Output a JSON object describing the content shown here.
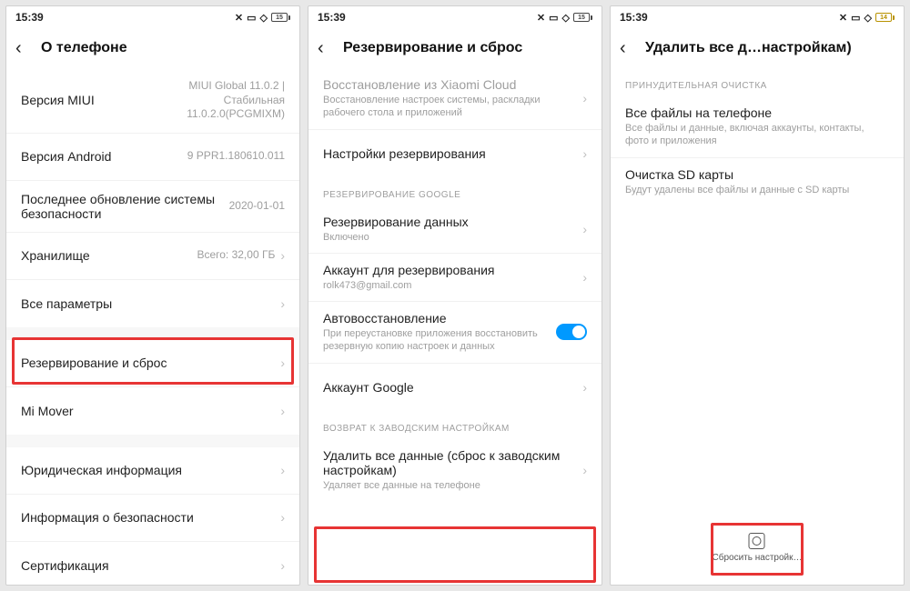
{
  "status": {
    "time": "15:39",
    "battery1": "15",
    "battery2": "15",
    "battery3": "14"
  },
  "s1": {
    "title": "О телефоне",
    "rows": {
      "miui_l": "Версия MIUI",
      "miui_v": "MIUI Global 11.0.2 | Стабильная 11.0.2.0(PCGMIXM)",
      "android_l": "Версия Android",
      "android_v": "9 PPR1.180610.011",
      "security_l": "Последнее обновление системы безопасности",
      "security_v": "2020-01-01",
      "storage_l": "Хранилище",
      "storage_v": "Всего: 32,00 ГБ",
      "allparams": "Все параметры",
      "backup": "Резервирование и сброс",
      "mover": "Mi Mover",
      "legal": "Юридическая информация",
      "secinfo": "Информация о безопасности",
      "cert": "Сертификация"
    }
  },
  "s2": {
    "title": "Резервирование и сброс",
    "rows": {
      "xiaomi_t": "Восстановление из Xiaomi Cloud",
      "xiaomi_s": "Восстановление настроек системы, раскладки рабочего стола и приложений",
      "backup_settings": "Настройки резервирования",
      "sec_google": "РЕЗЕРВИРОВАНИЕ GOOGLE",
      "data_t": "Резервирование данных",
      "data_s": "Включено",
      "acct_t": "Аккаунт для резервирования",
      "acct_s": "rolk473@gmail.com",
      "auto_t": "Автовосстановление",
      "auto_s": "При переустановке приложения восстановить резервную копию настроек и данных",
      "google_acct": "Аккаунт Google",
      "sec_factory": "ВОЗВРАТ К ЗАВОДСКИМ НАСТРОЙКАМ",
      "erase_t": "Удалить все данные (сброс к заводским настройкам)",
      "erase_s": "Удаляет все данные на телефоне"
    }
  },
  "s3": {
    "title": "Удалить все д…настройкам)",
    "sec_force": "ПРИНУДИТЕЛЬНАЯ ОЧИСТКА",
    "rows": {
      "all_t": "Все файлы на телефоне",
      "all_s": "Все файлы и данные, включая аккаунты, контакты, фото и приложения",
      "sd_t": "Очистка SD карты",
      "sd_s": "Будут удалены все файлы и данные с SD карты"
    },
    "reset_btn": "Сбросить настройк…"
  }
}
